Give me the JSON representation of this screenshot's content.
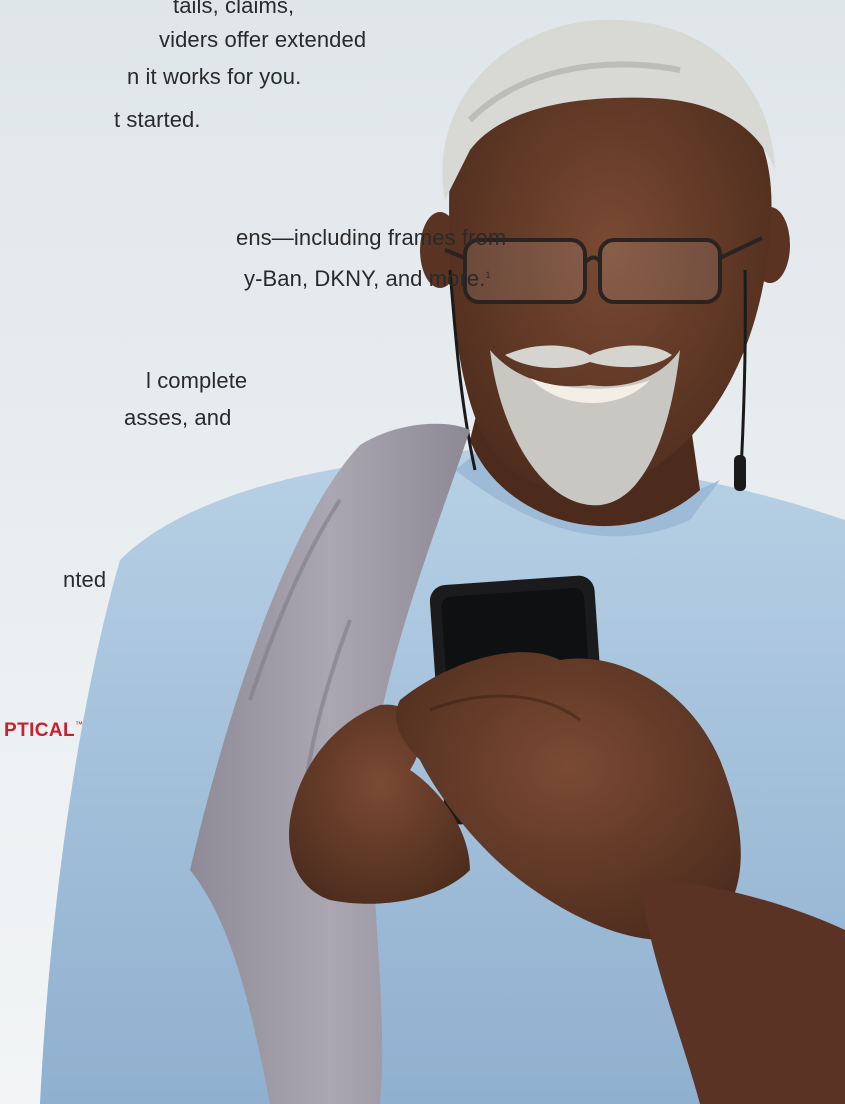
{
  "body_text": {
    "line_1": "tails, claims,",
    "line_2": "viders offer extended",
    "line_3": "n it works for you.",
    "line_4": "t started.",
    "line_5": "ens—including frames from",
    "line_6": "y-Ban, DKNY, and more.",
    "footnote_marker": "1",
    "line_7": "l complete",
    "line_8": "asses, and",
    "line_9": "nted"
  },
  "brand": {
    "name": "PTICAL",
    "trademark": "™"
  },
  "photo": {
    "subject": "man-with-glasses-and-towel-using-phone",
    "colors": {
      "sky": "#e6ecef",
      "shirt": "#a9c6df",
      "towel": "#9f9aa6",
      "skin": "#6b3f2a",
      "hair": "#d9d9d6",
      "phone": "#1b1b1d",
      "brand_red": "#c8202f"
    }
  }
}
